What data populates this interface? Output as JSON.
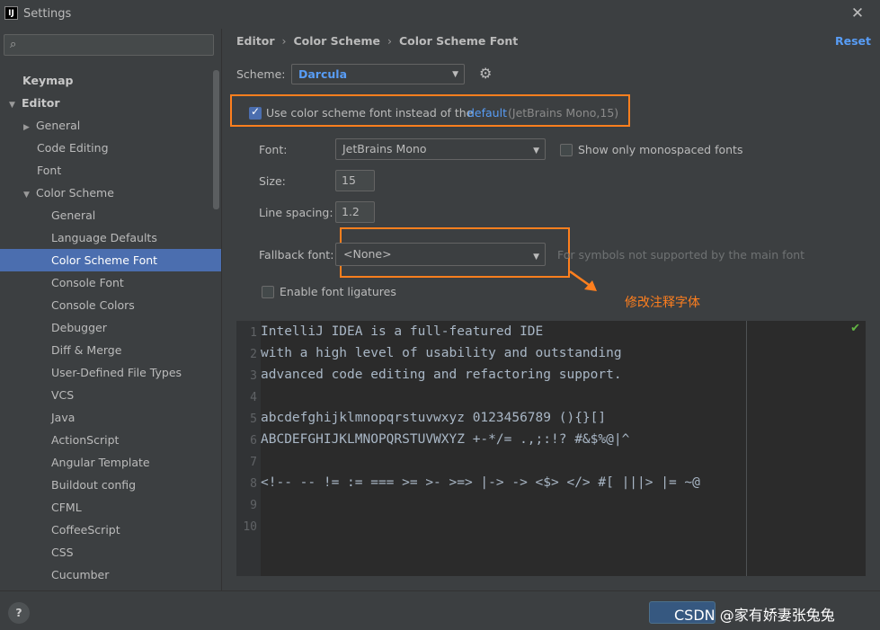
{
  "window": {
    "title": "Settings",
    "app_icon_text": "IJ",
    "close_glyph": "✕"
  },
  "sidebar": {
    "search": {
      "value": "",
      "placeholder": ""
    },
    "items": [
      {
        "label": "Keymap",
        "level": 0,
        "bold": true,
        "arrow": ""
      },
      {
        "label": "Editor",
        "level": 0,
        "bold": true,
        "arrow": "▼"
      },
      {
        "label": "General",
        "level": 1,
        "arrow": "▶"
      },
      {
        "label": "Code Editing",
        "level": 2,
        "arrow": ""
      },
      {
        "label": "Font",
        "level": 2,
        "arrow": ""
      },
      {
        "label": "Color Scheme",
        "level": 1,
        "arrow": "▼"
      },
      {
        "label": "General",
        "level": 3,
        "arrow": ""
      },
      {
        "label": "Language Defaults",
        "level": 3,
        "arrow": ""
      },
      {
        "label": "Color Scheme Font",
        "level": 3,
        "arrow": "",
        "selected": true
      },
      {
        "label": "Console Font",
        "level": 3,
        "arrow": ""
      },
      {
        "label": "Console Colors",
        "level": 3,
        "arrow": ""
      },
      {
        "label": "Debugger",
        "level": 3,
        "arrow": ""
      },
      {
        "label": "Diff & Merge",
        "level": 3,
        "arrow": ""
      },
      {
        "label": "User-Defined File Types",
        "level": 3,
        "arrow": ""
      },
      {
        "label": "VCS",
        "level": 3,
        "arrow": ""
      },
      {
        "label": "Java",
        "level": 3,
        "arrow": ""
      },
      {
        "label": "ActionScript",
        "level": 3,
        "arrow": ""
      },
      {
        "label": "Angular Template",
        "level": 3,
        "arrow": ""
      },
      {
        "label": "Buildout config",
        "level": 3,
        "arrow": ""
      },
      {
        "label": "CFML",
        "level": 3,
        "arrow": ""
      },
      {
        "label": "CoffeeScript",
        "level": 3,
        "arrow": ""
      },
      {
        "label": "CSS",
        "level": 3,
        "arrow": ""
      },
      {
        "label": "Cucumber",
        "level": 3,
        "arrow": ""
      }
    ]
  },
  "breadcrumb": {
    "part1": "Editor",
    "part2": "Color Scheme",
    "part3": "Color Scheme Font",
    "separator": "›"
  },
  "reset_label": "Reset",
  "scheme": {
    "label": "Scheme:",
    "value": "Darcula"
  },
  "use_scheme_font": {
    "checked": true,
    "label": "Use color scheme font instead of the",
    "link": "default",
    "info": "(JetBrains Mono,15)"
  },
  "font": {
    "label": "Font:",
    "value": "JetBrains Mono"
  },
  "mono_only": {
    "checked": false,
    "label": "Show only monospaced fonts"
  },
  "size": {
    "label": "Size:",
    "value": "15"
  },
  "line_spacing": {
    "label": "Line spacing:",
    "value": "1.2"
  },
  "fallback": {
    "label": "Fallback font:",
    "value": "<None>",
    "hint": "For symbols not supported by the main font"
  },
  "ligatures": {
    "checked": false,
    "label": "Enable font ligatures"
  },
  "annotation": "修改注释字体",
  "preview": {
    "lines": [
      "IntelliJ IDEA is a full-featured IDE",
      "with a high level of usability and outstanding",
      "advanced code editing and refactoring support.",
      "",
      "abcdefghijklmnopqrstuvwxyz 0123456789 (){}[]",
      "ABCDEFGHIJKLMNOPQRSTUVWXYZ +-*/= .,;:!? #&$%@|^",
      "",
      "<!-- -- != := === >= >- >=> |-> -> <$> </> #[ |||> |= ~@",
      "",
      ""
    ]
  },
  "bottom": {
    "help_label": "?",
    "watermark": "CSDN @家有娇妻张兔兔"
  },
  "colors": {
    "accent": "#4b6eaf",
    "link": "#589df6",
    "annotation": "#ff7f1e",
    "ok": "#62b543"
  }
}
